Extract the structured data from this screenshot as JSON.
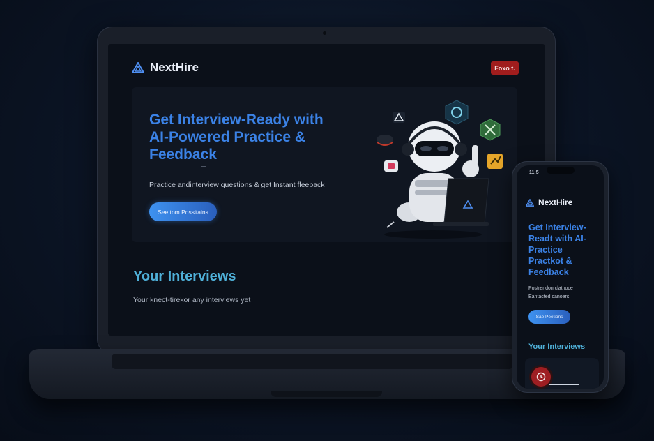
{
  "desktop": {
    "brand": {
      "name": "NextHire"
    },
    "top_button": "Foxo t.",
    "hero": {
      "title_lines": [
        "Get Interview-Ready with",
        "AI-Powered Practice &",
        "Feedback"
      ],
      "dash": "—",
      "subtitle": "Practice andinterview questions & get Instant fleeback",
      "cta": "See tom Possitains"
    },
    "interviews": {
      "title": "Your Interviews",
      "empty": "Your knect-tirekor any interviews yet"
    }
  },
  "mobile": {
    "status": "11:5",
    "brand": {
      "name": "NextHire"
    },
    "title_lines": [
      "Get Interview-",
      "Readt with AI-",
      "Practice",
      "Practkot &",
      "Feedback"
    ],
    "desc_lines": [
      "Postrendon clathoce",
      "Eantacted canoers"
    ],
    "cta": "Sae Peetions",
    "section": "Your Interviews"
  },
  "colors": {
    "accent_blue": "#3b82e6",
    "section_teal": "#4fb0d8",
    "danger_red": "#a01d1d",
    "background": "#0b1019"
  },
  "icons": [
    "nexthire-logo-icon",
    "robot-illustration",
    "settings-badge-icon",
    "tools-badge-icon",
    "chart-badge-icon",
    "clock-icon"
  ]
}
